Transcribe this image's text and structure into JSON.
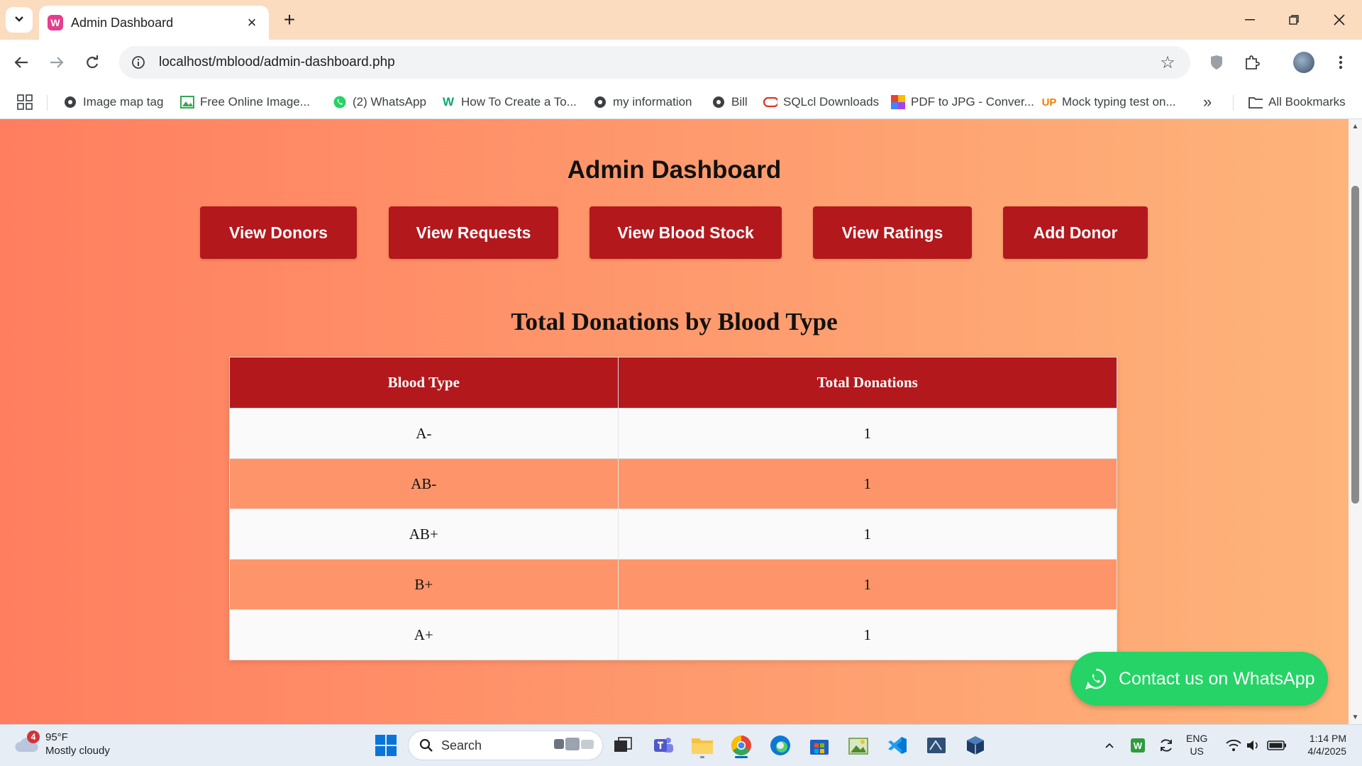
{
  "browser": {
    "tab_title": "Admin Dashboard",
    "url": "localhost/mblood/admin-dashboard.php",
    "bookmarks": [
      {
        "label": "Image map tag",
        "icon": "globe-icon"
      },
      {
        "label": "Free Online Image...",
        "icon": "image-icon"
      },
      {
        "label": "(2) WhatsApp",
        "icon": "whatsapp-icon"
      },
      {
        "label": "How To Create a To...",
        "icon": "w3-icon"
      },
      {
        "label": "my information",
        "icon": "globe-icon"
      },
      {
        "label": "Bill",
        "icon": "globe-icon"
      },
      {
        "label": "SQLcl Downloads",
        "icon": "oracle-icon"
      },
      {
        "label": "PDF to JPG - Conver...",
        "icon": "grid-color-icon"
      },
      {
        "label": "Mock typing test on...",
        "icon": "up-icon"
      }
    ],
    "all_bookmarks": "All Bookmarks"
  },
  "page": {
    "title": "Admin Dashboard",
    "buttons": [
      "View Donors",
      "View Requests",
      "View Blood Stock",
      "View Ratings",
      "Add Donor"
    ],
    "section_title": "Total Donations by Blood Type",
    "table": {
      "headers": [
        "Blood Type",
        "Total Donations"
      ],
      "rows": [
        [
          "A-",
          "1"
        ],
        [
          "AB-",
          "1"
        ],
        [
          "AB+",
          "1"
        ],
        [
          "B+",
          "1"
        ],
        [
          "A+",
          "1"
        ]
      ]
    },
    "whatsapp_label": "Contact us on WhatsApp"
  },
  "taskbar": {
    "weather_badge": "4",
    "temperature": "95°F",
    "condition": "Mostly cloudy",
    "search_label": "Search",
    "lang_1": "ENG",
    "lang_2": "US",
    "time": "1:14 PM",
    "date": "4/4/2025"
  },
  "colors": {
    "gradient_start": "#ff7e5f",
    "gradient_end": "#feb47b",
    "button_red": "#b3181d",
    "row_alt": "#fe956a",
    "whatsapp_green": "#25d366"
  }
}
